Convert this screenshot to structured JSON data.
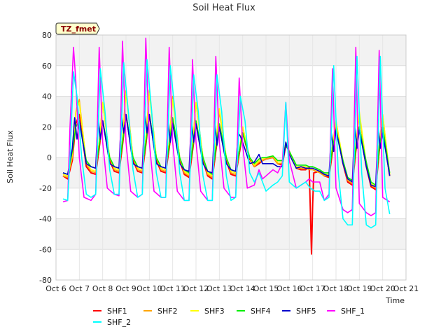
{
  "chart_data": {
    "type": "line",
    "title": "Soil Heat Flux",
    "xlabel": "Time",
    "ylabel": "Soil Heat Flux",
    "ylim": [
      -80,
      80
    ],
    "xlim": [
      6,
      21
    ],
    "yticks": [
      -80,
      -60,
      -40,
      -20,
      0,
      20,
      40,
      60,
      80
    ],
    "xticks": [
      {
        "value": 6,
        "label": "Oct 6"
      },
      {
        "value": 7,
        "label": "Oct 7"
      },
      {
        "value": 8,
        "label": "Oct 8"
      },
      {
        "value": 9,
        "label": "Oct 9"
      },
      {
        "value": 10,
        "label": "Oct 10"
      },
      {
        "value": 11,
        "label": "Oct 11"
      },
      {
        "value": 12,
        "label": "Oct 12"
      },
      {
        "value": 13,
        "label": "Oct 13"
      },
      {
        "value": 14,
        "label": "Oct 14"
      },
      {
        "value": 15,
        "label": "Oct 15"
      },
      {
        "value": 16,
        "label": "Oct 16"
      },
      {
        "value": 17,
        "label": "Oct 17"
      },
      {
        "value": 18,
        "label": "Oct 18"
      },
      {
        "value": 19,
        "label": "Oct 19"
      },
      {
        "value": 20,
        "label": "Oct 20"
      },
      {
        "value": 21,
        "label": "Oct 21"
      }
    ],
    "grid": true,
    "legend_position": "bottom",
    "annotation": "TZ_fmet",
    "series_colors": {
      "SHF1": "#ff0000",
      "SHF2": "#ffa500",
      "SHF3": "#ffff00",
      "SHF4": "#00ee00",
      "SHF5": "#0000cc",
      "SHF_1": "#ff00ff",
      "SHF_2": "#00ffff"
    },
    "series": [
      {
        "name": "SHF1",
        "x": [
          6.3,
          6.5,
          6.7,
          6.85,
          7.0,
          7.3,
          7.5,
          7.7,
          7.85,
          8.0,
          8.3,
          8.5,
          8.7,
          8.85,
          9.0,
          9.3,
          9.5,
          9.7,
          9.85,
          10.0,
          10.3,
          10.5,
          10.7,
          10.85,
          11.0,
          11.3,
          11.5,
          11.7,
          11.85,
          12.0,
          12.3,
          12.5,
          12.7,
          12.85,
          13.0,
          13.3,
          13.5,
          13.7,
          13.85,
          14.0,
          14.3,
          14.5,
          14.7,
          14.85,
          15.0,
          15.3,
          15.5,
          15.7,
          15.85,
          16.0,
          16.3,
          16.5,
          16.7,
          16.85,
          16.95,
          17.0,
          17.05,
          17.3,
          17.5,
          17.7,
          17.85,
          18.0,
          18.3,
          18.5,
          18.7,
          18.85,
          19.0,
          19.3,
          19.5,
          19.7,
          19.85,
          20.0,
          20.3
        ],
        "y": [
          -12,
          -14,
          -2,
          22,
          28,
          -6,
          -10,
          -11,
          6,
          24,
          -2,
          -9,
          -10,
          8,
          28,
          -2,
          -9,
          -10,
          8,
          28,
          -2,
          -9,
          -10,
          6,
          24,
          -2,
          -11,
          -13,
          4,
          22,
          -2,
          -12,
          -14,
          4,
          20,
          -2,
          -11,
          -12,
          2,
          16,
          -1,
          -6,
          -4,
          -2,
          -1,
          0,
          -4,
          -5,
          8,
          4,
          -7,
          -8,
          -8,
          -6,
          -63,
          -30,
          -10,
          -9,
          -12,
          -13,
          4,
          20,
          -4,
          -16,
          -18,
          4,
          20,
          -6,
          -19,
          -21,
          4,
          20,
          -12
        ]
      },
      {
        "name": "SHF2",
        "x": [
          6.3,
          6.5,
          6.7,
          6.85,
          7.0,
          7.3,
          7.5,
          7.7,
          7.85,
          8.0,
          8.3,
          8.5,
          8.7,
          8.85,
          9.0,
          9.3,
          9.5,
          9.7,
          9.85,
          10.0,
          10.3,
          10.5,
          10.7,
          10.85,
          11.0,
          11.3,
          11.5,
          11.7,
          11.85,
          12.0,
          12.3,
          12.5,
          12.7,
          12.85,
          13.0,
          13.3,
          13.5,
          13.7,
          13.85,
          14.0,
          14.3,
          14.5,
          14.7,
          14.85,
          15.0,
          15.3,
          15.5,
          15.7,
          15.85,
          16.0,
          16.3,
          16.5,
          16.7,
          16.85,
          17.0,
          17.3,
          17.5,
          17.7,
          17.85,
          18.0,
          18.3,
          18.5,
          18.7,
          18.85,
          19.0,
          19.3,
          19.5,
          19.7,
          19.85,
          20.0,
          20.3
        ],
        "y": [
          -12,
          -13,
          0,
          30,
          38,
          -4,
          -9,
          -10,
          10,
          36,
          0,
          -8,
          -9,
          12,
          44,
          0,
          -8,
          -9,
          12,
          44,
          0,
          -8,
          -9,
          10,
          40,
          0,
          -10,
          -12,
          8,
          36,
          0,
          -11,
          -13,
          8,
          30,
          0,
          -10,
          -11,
          4,
          20,
          0,
          -6,
          -3,
          -2,
          -1,
          0,
          -4,
          -4,
          10,
          4,
          -7,
          -7,
          -7,
          -8,
          -8,
          -10,
          -12,
          -12,
          8,
          24,
          -3,
          -15,
          -17,
          8,
          28,
          -5,
          -18,
          -20,
          8,
          28,
          -12
        ]
      },
      {
        "name": "SHF3",
        "x": [
          6.3,
          6.5,
          6.7,
          6.85,
          7.0,
          7.3,
          7.5,
          7.7,
          7.85,
          8.0,
          8.3,
          8.5,
          8.7,
          8.85,
          9.0,
          9.3,
          9.5,
          9.7,
          9.85,
          10.0,
          10.3,
          10.5,
          10.7,
          10.85,
          11.0,
          11.3,
          11.5,
          11.7,
          11.85,
          12.0,
          12.3,
          12.5,
          12.7,
          12.85,
          13.0,
          13.3,
          13.5,
          13.7,
          13.85,
          14.0,
          14.3,
          14.5,
          14.7,
          14.85,
          15.0,
          15.3,
          15.5,
          15.7,
          15.85,
          16.0,
          16.3,
          16.5,
          16.7,
          16.85,
          17.0,
          17.3,
          17.5,
          17.7,
          17.85,
          18.0,
          18.3,
          18.5,
          18.7,
          18.85,
          19.0,
          19.3,
          19.5,
          19.7,
          19.85,
          20.0,
          20.3
        ],
        "y": [
          -11,
          -12,
          2,
          30,
          36,
          -3,
          -8,
          -9,
          10,
          36,
          0,
          -7,
          -8,
          12,
          42,
          0,
          -7,
          -8,
          12,
          42,
          0,
          -7,
          -8,
          10,
          38,
          0,
          -9,
          -11,
          8,
          36,
          0,
          -10,
          -12,
          8,
          32,
          0,
          -9,
          -10,
          4,
          20,
          0,
          -5,
          -2,
          -1,
          0,
          1,
          -3,
          -3,
          10,
          4,
          -6,
          -6,
          -6,
          -7,
          -7,
          -9,
          -11,
          -11,
          8,
          24,
          -2,
          -14,
          -16,
          8,
          30,
          -4,
          -17,
          -19,
          8,
          28,
          -11
        ]
      },
      {
        "name": "SHF4",
        "x": [
          6.3,
          6.5,
          6.7,
          6.85,
          7.0,
          7.3,
          7.5,
          7.7,
          7.85,
          8.0,
          8.3,
          8.5,
          8.7,
          8.85,
          9.0,
          9.3,
          9.5,
          9.7,
          9.85,
          10.0,
          10.3,
          10.5,
          10.7,
          10.85,
          11.0,
          11.3,
          11.5,
          11.7,
          11.85,
          12.0,
          12.3,
          12.5,
          12.7,
          12.85,
          13.0,
          13.3,
          13.5,
          13.7,
          13.85,
          14.0,
          14.3,
          14.5,
          14.7,
          14.85,
          15.0,
          15.3,
          15.5,
          15.7,
          15.85,
          16.0,
          16.3,
          16.5,
          16.7,
          16.85,
          17.0,
          17.3,
          17.5,
          17.7,
          17.85,
          18.0,
          18.3,
          18.5,
          18.7,
          18.85,
          19.0,
          19.3,
          19.5,
          19.7,
          19.85,
          20.0,
          20.3
        ],
        "y": [
          -10,
          -11,
          4,
          20,
          24,
          -2,
          -6,
          -7,
          8,
          24,
          0,
          -6,
          -7,
          10,
          28,
          0,
          -6,
          -7,
          10,
          28,
          0,
          -6,
          -7,
          8,
          26,
          0,
          -8,
          -10,
          6,
          24,
          0,
          -9,
          -11,
          6,
          22,
          0,
          -8,
          -9,
          4,
          16,
          0,
          -4,
          -1,
          0,
          0,
          1,
          -2,
          -2,
          8,
          4,
          -5,
          -5,
          -5,
          -6,
          -6,
          -8,
          -10,
          -10,
          6,
          18,
          -2,
          -13,
          -15,
          6,
          20,
          -3,
          -16,
          -18,
          6,
          20,
          -10
        ]
      },
      {
        "name": "SHF5",
        "x": [
          6.3,
          6.5,
          6.7,
          6.8,
          6.9,
          7.0,
          7.3,
          7.5,
          7.7,
          7.8,
          7.9,
          8.0,
          8.3,
          8.5,
          8.7,
          8.8,
          8.9,
          9.0,
          9.3,
          9.5,
          9.7,
          9.8,
          9.9,
          10.0,
          10.3,
          10.5,
          10.7,
          10.8,
          10.9,
          11.0,
          11.3,
          11.5,
          11.7,
          11.8,
          11.9,
          12.0,
          12.3,
          12.5,
          12.7,
          12.8,
          12.9,
          13.0,
          13.3,
          13.5,
          13.7,
          13.8,
          13.9,
          14.0,
          14.3,
          14.5,
          14.7,
          14.85,
          15.0,
          15.3,
          15.5,
          15.7,
          15.85,
          16.0,
          16.3,
          16.5,
          16.7,
          16.85,
          17.0,
          17.3,
          17.5,
          17.7,
          17.8,
          17.9,
          18.0,
          18.3,
          18.5,
          18.7,
          18.8,
          18.9,
          19.0,
          19.3,
          19.5,
          19.7,
          19.8,
          19.9,
          20.0,
          20.3
        ],
        "y": [
          -10,
          -11,
          6,
          26,
          12,
          24,
          -4,
          -6,
          -7,
          26,
          12,
          24,
          -4,
          -6,
          -7,
          28,
          16,
          28,
          -4,
          -6,
          -7,
          30,
          16,
          28,
          -4,
          -6,
          -7,
          24,
          10,
          22,
          -4,
          -8,
          -9,
          24,
          10,
          22,
          -4,
          -9,
          -10,
          24,
          8,
          20,
          -4,
          -8,
          -9,
          16,
          14,
          10,
          -4,
          -3,
          2,
          -4,
          -4,
          -4,
          -6,
          -6,
          10,
          2,
          -7,
          -6,
          -7,
          -7,
          -7,
          -9,
          -11,
          -12,
          16,
          4,
          18,
          -4,
          -14,
          -16,
          22,
          6,
          18,
          -6,
          -18,
          -19,
          20,
          6,
          16,
          -12
        ]
      },
      {
        "name": "SHF_1",
        "x": [
          6.3,
          6.5,
          6.6,
          6.75,
          6.85,
          7.0,
          7.2,
          7.5,
          7.7,
          7.85,
          8.0,
          8.2,
          8.5,
          8.7,
          8.85,
          9.0,
          9.2,
          9.5,
          9.7,
          9.85,
          10.0,
          10.2,
          10.5,
          10.7,
          10.85,
          11.0,
          11.2,
          11.5,
          11.7,
          11.85,
          12.0,
          12.2,
          12.5,
          12.7,
          12.85,
          13.0,
          13.2,
          13.5,
          13.7,
          13.85,
          14.0,
          14.2,
          14.5,
          14.7,
          14.85,
          15.0,
          15.3,
          15.5,
          15.7,
          15.85,
          16.0,
          16.3,
          16.5,
          16.7,
          16.85,
          17.0,
          17.3,
          17.5,
          17.7,
          17.85,
          18.0,
          18.3,
          18.5,
          18.7,
          18.85,
          19.0,
          19.3,
          19.5,
          19.7,
          19.85,
          20.0,
          20.3
        ],
        "y": [
          -29,
          -28,
          20,
          72,
          50,
          0,
          -26,
          -28,
          -24,
          72,
          10,
          -20,
          -24,
          -25,
          76,
          10,
          -22,
          -26,
          -24,
          78,
          10,
          -22,
          -26,
          -26,
          72,
          10,
          -22,
          -28,
          -28,
          64,
          10,
          -22,
          -28,
          -28,
          66,
          10,
          -20,
          -26,
          -26,
          52,
          8,
          -20,
          -18,
          -8,
          -14,
          -12,
          -8,
          -10,
          -4,
          36,
          -2,
          -20,
          -18,
          -16,
          -14,
          -16,
          -16,
          -28,
          -24,
          58,
          -20,
          -34,
          -36,
          -34,
          72,
          -30,
          -36,
          -38,
          -36,
          70,
          -26,
          -29
        ]
      },
      {
        "name": "SHF_2",
        "x": [
          6.3,
          6.5,
          6.6,
          6.75,
          6.9,
          7.1,
          7.3,
          7.5,
          7.7,
          7.9,
          8.1,
          8.3,
          8.5,
          8.7,
          8.9,
          9.1,
          9.3,
          9.5,
          9.7,
          9.9,
          10.1,
          10.3,
          10.5,
          10.7,
          10.9,
          11.1,
          11.3,
          11.5,
          11.7,
          11.9,
          12.1,
          12.3,
          12.5,
          12.7,
          12.9,
          13.1,
          13.3,
          13.5,
          13.7,
          13.9,
          14.1,
          14.3,
          14.5,
          14.7,
          14.9,
          15.0,
          15.3,
          15.5,
          15.7,
          15.85,
          16.0,
          16.3,
          16.5,
          16.7,
          16.9,
          17.1,
          17.3,
          17.5,
          17.7,
          17.9,
          18.1,
          18.3,
          18.5,
          18.7,
          18.9,
          19.1,
          19.3,
          19.5,
          19.7,
          19.9,
          20.1,
          20.3
        ],
        "y": [
          -27,
          -28,
          0,
          56,
          40,
          0,
          -24,
          -26,
          -24,
          58,
          30,
          -8,
          -24,
          -24,
          62,
          30,
          -8,
          -26,
          -24,
          64,
          30,
          -10,
          -26,
          -26,
          60,
          30,
          -10,
          -28,
          -28,
          54,
          30,
          -12,
          -28,
          -28,
          54,
          30,
          -12,
          -28,
          -26,
          40,
          24,
          -10,
          -16,
          -10,
          -18,
          -22,
          -18,
          -16,
          -12,
          36,
          -16,
          -20,
          -18,
          -16,
          -20,
          -22,
          -22,
          -28,
          -26,
          60,
          -10,
          -40,
          -44,
          -44,
          66,
          -10,
          -44,
          -46,
          -44,
          66,
          -20,
          -37
        ]
      }
    ]
  }
}
